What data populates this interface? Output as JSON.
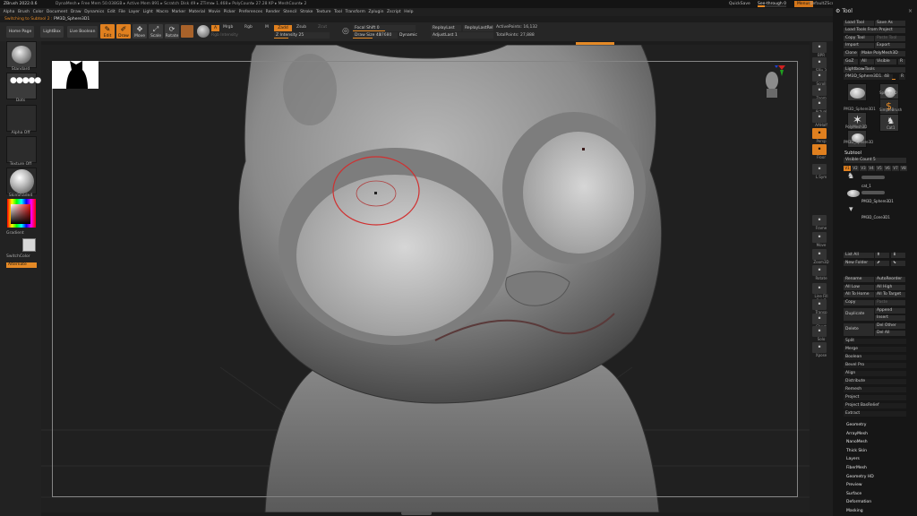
{
  "titlebar": {
    "app": "ZBrush 2022.0.6",
    "stats": "DynaMesh  ▸ Free Mem 50.038GB ▸ Active Mem 891 ▸ Scratch Disk 49 ▸ ZTime▸ 1.468 ▸ PolyCount▸ 27.28 KP ▸ MeshCount▸ 2",
    "quicksave": "QuickSave",
    "see_through": "See-through 0",
    "menus": "Menus",
    "default_script": "DefaultZScript",
    "window_buttons": "– □ ×"
  },
  "menubar": [
    "Alpha",
    "Brush",
    "Color",
    "Document",
    "Draw",
    "Dynamics",
    "Edit",
    "File",
    "Layer",
    "Light",
    "Macro",
    "Marker",
    "Material",
    "Movie",
    "Picker",
    "Preferences",
    "Render",
    "Stencil",
    "Stroke",
    "Texture",
    "Tool",
    "Transform",
    "Zplugin",
    "Zscript",
    "Help"
  ],
  "status": {
    "switching": "Switching to Subtool 2 :",
    "tool_name": "PM3D_Sphere3D1"
  },
  "shelf": {
    "home_page": "Home Page",
    "lightbox": "LightBox",
    "live_boolean": "Live Boolean",
    "edit": "Edit",
    "draw": "Draw",
    "move": "Move",
    "scale": "Scale",
    "rotate": "Rotate",
    "a": "A",
    "mrgb": "Mrgb",
    "rgb": "Rgb",
    "m": "M",
    "rgb_intensity": "Rgb Intensity",
    "zadd": "Zadd",
    "zsub": "Zsub",
    "zcut": "Zcut",
    "z_intensity": "Z Intensity 25",
    "focal_shift": "Focal Shift 0",
    "draw_size": "Draw Size 41",
    "draw_size_dyn": "87680",
    "dynamic": "Dynamic",
    "replay_last": "ReplayLast",
    "replay_last_rel": "ReplayLastRel",
    "adjust_last": "AdjustLast 1",
    "active_points": "ActivePoints: 16,132",
    "total_points": "TotalPoints: 27,888"
  },
  "left": {
    "brush": "Standard",
    "stroke": "Dots",
    "alpha": "Alpha Off",
    "texture": "Texture Off",
    "material": "SkinShade4",
    "gradient": "Gradient",
    "switch_color": "SwitchColor",
    "alternate": "Alternate"
  },
  "right_shelf": [
    "BPR",
    "SPix 3",
    "Scroll",
    "Zoom",
    "Actual",
    "AAHalf",
    "Persp",
    "Floor",
    "L.Sym",
    "Frame",
    "Move",
    "Zoom3D",
    "Rotate",
    "Line Fill PolyF",
    "Transp",
    "Ghost",
    "Solo",
    "Xpose"
  ],
  "tool": {
    "header": "Tool",
    "load_tool": "Load Tool",
    "save_as": "Save As",
    "load_from_project": "Load Tools From Project",
    "copy_tool": "Copy Tool",
    "paste_tool": "Paste Tool",
    "import": "Import",
    "export": "Export",
    "clone": "Clone",
    "make_polymesh": "Make PolyMesh3D",
    "goz": "GoZ",
    "all": "All",
    "visible": "Visible",
    "r": "R",
    "lightbox_tools": "Lightbox▸Tools",
    "current_tool": "PM3D_Sphere3D1. 48",
    "thumbs": [
      "PM3D_Sphere3D1",
      "Sphere3D",
      "PM3D_Sphere3D",
      "SimpleBrush",
      "PolyMesh3D",
      "Cat1",
      "PM3D_Sphere3D"
    ],
    "subtool": "Subtool",
    "visible_count": "Visible Count 5",
    "v_tabs": [
      "V1",
      "V2",
      "V3",
      "V4",
      "V5",
      "V6",
      "V7",
      "V8"
    ],
    "subtools": [
      "cat_1",
      "PM3D_Sphere3D1",
      "PM3D_Cone3D1"
    ],
    "list_all": "List All",
    "new_folder": "New Folder",
    "rename": "Rename",
    "auto_reorder": "AutoReorder",
    "all_low": "All Low",
    "all_high": "All High",
    "all_to_home": "All To Home",
    "all_to_target": "All To Target",
    "copy": "Copy",
    "paste": "Paste",
    "duplicate": "Duplicate",
    "append": "Append",
    "insert": "Insert",
    "delete": "Delete",
    "del_other": "Del Other",
    "del_all": "Del All",
    "actions": [
      "Split",
      "Merge",
      "Boolean",
      "Bevel Pro",
      "Align",
      "Distribute",
      "Remesh",
      "Project",
      "Project BasRelief",
      "Extract"
    ],
    "sections": [
      "Geometry",
      "ArrayMesh",
      "NanoMesh",
      "Thick Skin",
      "Layers",
      "FiberMesh",
      "Geometry HD",
      "Preview",
      "Surface",
      "Deformation",
      "Masking"
    ]
  },
  "colors": {
    "accent": "#e58a26",
    "viewport": "#202020",
    "panel": "#161616"
  }
}
